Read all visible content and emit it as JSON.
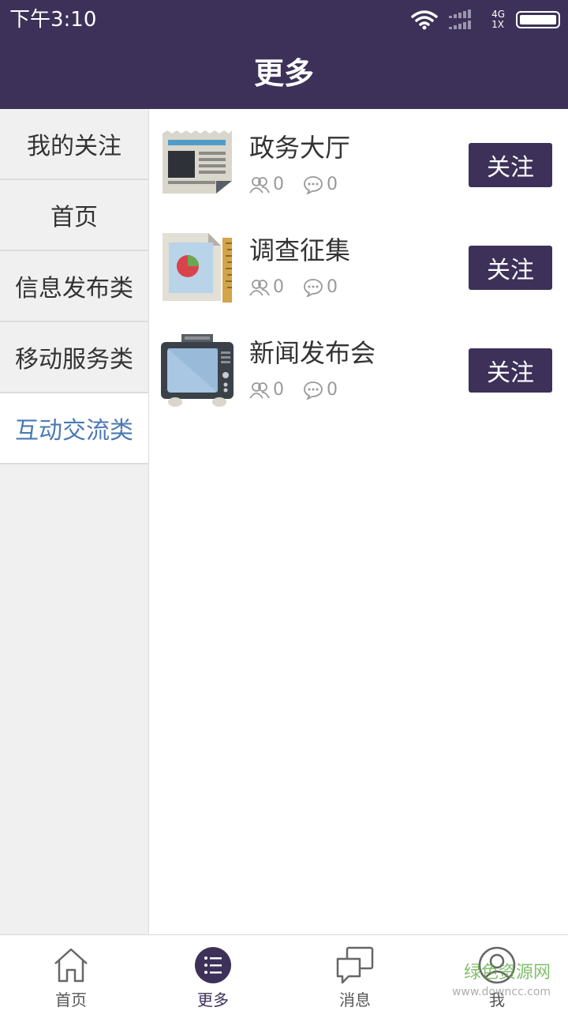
{
  "status_bar": {
    "time": "下午3:10",
    "network_top": "4G",
    "network_bottom": "1X"
  },
  "header": {
    "title": "更多"
  },
  "sidebar": {
    "items": [
      {
        "label": "我的关注",
        "active": false
      },
      {
        "label": "首页",
        "active": false
      },
      {
        "label": "信息发布类",
        "active": false
      },
      {
        "label": "移动服务类",
        "active": false
      },
      {
        "label": "互动交流类",
        "active": true
      }
    ]
  },
  "channels": [
    {
      "title": "政务大厅",
      "followers": "0",
      "comments": "0",
      "button": "关注",
      "icon": "newspaper-icon"
    },
    {
      "title": "调查征集",
      "followers": "0",
      "comments": "0",
      "button": "关注",
      "icon": "survey-chart-icon"
    },
    {
      "title": "新闻发布会",
      "followers": "0",
      "comments": "0",
      "button": "关注",
      "icon": "tv-icon"
    }
  ],
  "tab_bar": {
    "tabs": [
      {
        "label": "首页",
        "icon": "home-icon"
      },
      {
        "label": "更多",
        "icon": "list-icon",
        "active": true
      },
      {
        "label": "消息",
        "icon": "message-icon"
      },
      {
        "label": "我",
        "icon": "profile-icon"
      }
    ]
  },
  "watermark": {
    "text": "绿色资源网",
    "sub": "www.downcc.com"
  },
  "colors": {
    "primary": "#3d3159",
    "active_text": "#4a7ab5",
    "sidebar_bg": "#f0f0f0"
  }
}
